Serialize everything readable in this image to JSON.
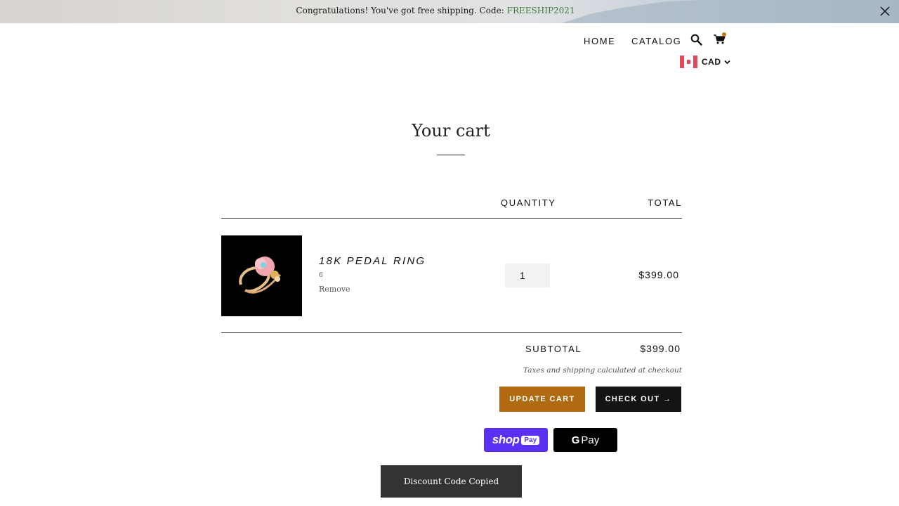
{
  "announcement": {
    "text": "Congratulations! You've got free shipping. Code: ",
    "code": "FREESHIP2021"
  },
  "nav": {
    "links": [
      {
        "label": "HOME"
      },
      {
        "label": "CATALOG"
      }
    ],
    "icons": [
      "search-icon",
      "cart-icon"
    ],
    "cart_indicator_color": "#c8741a"
  },
  "currency": {
    "selected": "CAD",
    "flag": "canada"
  },
  "page": {
    "title": "Your cart"
  },
  "cart": {
    "headers": {
      "quantity": "QUANTITY",
      "total": "TOTAL"
    },
    "items": [
      {
        "title": "18K PEDAL RING",
        "variant": "6",
        "remove_label": "Remove",
        "quantity": "1",
        "line_total": "$399.00"
      }
    ],
    "subtotal_label": "SUBTOTAL",
    "subtotal_value": "$399.00",
    "tax_note": "Taxes and shipping calculated at checkout",
    "update_label": "UPDATE CART",
    "checkout_label": "CHECK OUT →"
  },
  "payments": {
    "shop_pay": {
      "shop": "shop",
      "pay": "Pay"
    },
    "google_pay": {
      "g": "G",
      "pay": "Pay"
    }
  },
  "toast": {
    "text": "Discount Code Copied"
  },
  "colors": {
    "accent": "#b06a10",
    "code_green": "#3e7a3a",
    "shop_pay": "#5a31f4"
  }
}
